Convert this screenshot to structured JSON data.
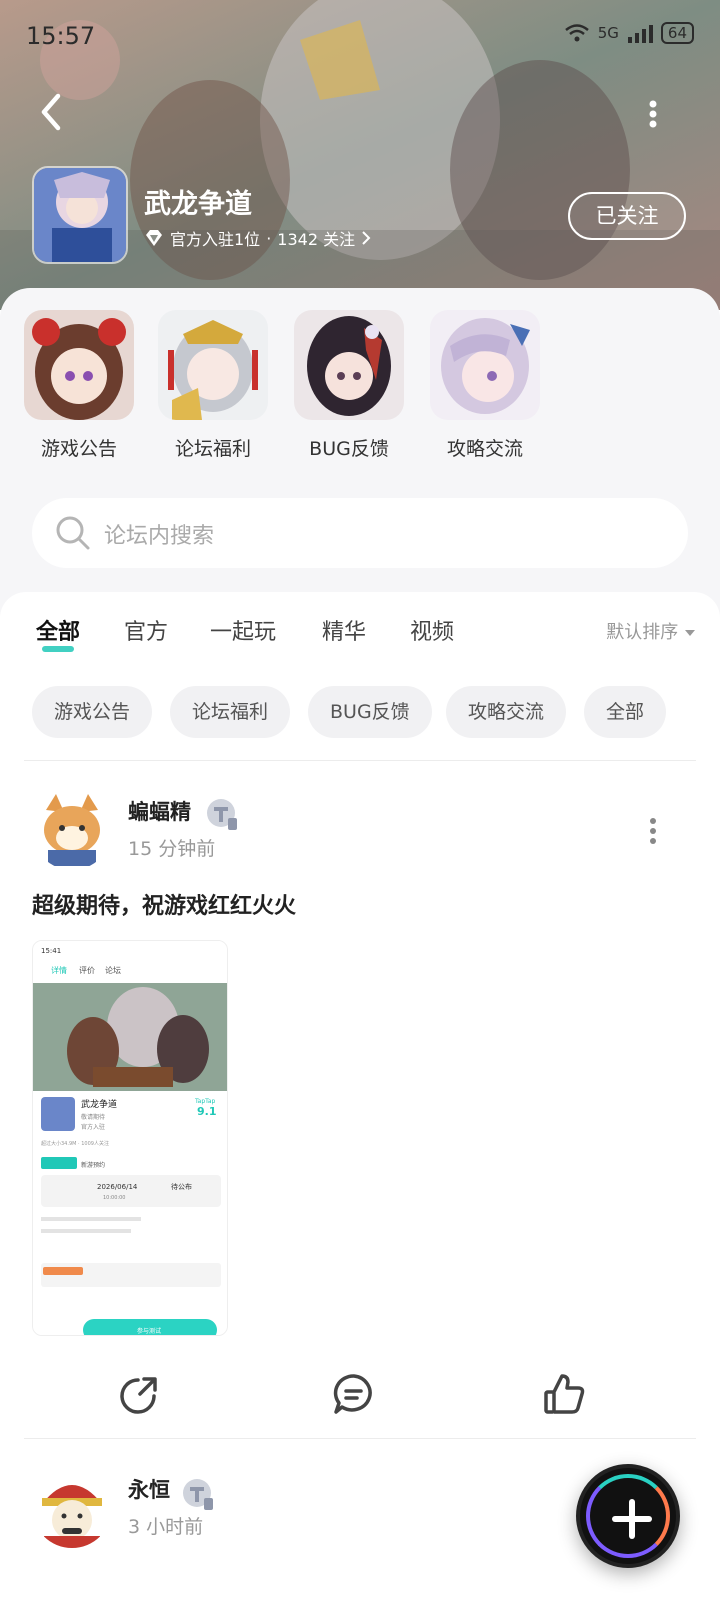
{
  "status_bar": {
    "time": "15:57",
    "network": "5G",
    "battery": "64"
  },
  "forum": {
    "title": "武龙争道",
    "official_residents": "官方入驻1位",
    "separator": "·",
    "followers": "1342 关注",
    "follow_label": "已关注"
  },
  "categories": [
    {
      "label": "游戏公告"
    },
    {
      "label": "论坛福利"
    },
    {
      "label": "BUG反馈"
    },
    {
      "label": "攻略交流"
    }
  ],
  "search": {
    "placeholder": "论坛内搜索"
  },
  "tabs": [
    {
      "label": "全部",
      "active": true
    },
    {
      "label": "官方"
    },
    {
      "label": "一起玩"
    },
    {
      "label": "精华"
    },
    {
      "label": "视频"
    }
  ],
  "sort": {
    "label": "默认排序"
  },
  "chips": [
    "游戏公告",
    "论坛福利",
    "BUG反馈",
    "攻略交流",
    "全部"
  ],
  "posts": [
    {
      "author": "蝙蝠精",
      "time": "15 分钟前",
      "text": "超级期待，祝游戏红红火火",
      "screenshot": {
        "time": "15:41",
        "tab_detail": "详情",
        "tab_review": "评价",
        "tab_forum": "论坛",
        "game_name": "武龙争道",
        "game_status": "敬请期待",
        "official": "官方入驻",
        "rating_brand": "TapTap",
        "rating": "9.1",
        "stats": "超过大小34.9M · 1009人关注",
        "tag": "新游预约",
        "date": "2026/06/14",
        "date_sub": "10:00:00",
        "status": "待公布",
        "join_label": "参与测试"
      }
    },
    {
      "author": "永恒",
      "time": "3 小时前"
    }
  ],
  "colors": {
    "accent": "#20c8b7",
    "chip_bg": "#f1f1f3",
    "sheet_bg": "#f6f6f8"
  }
}
